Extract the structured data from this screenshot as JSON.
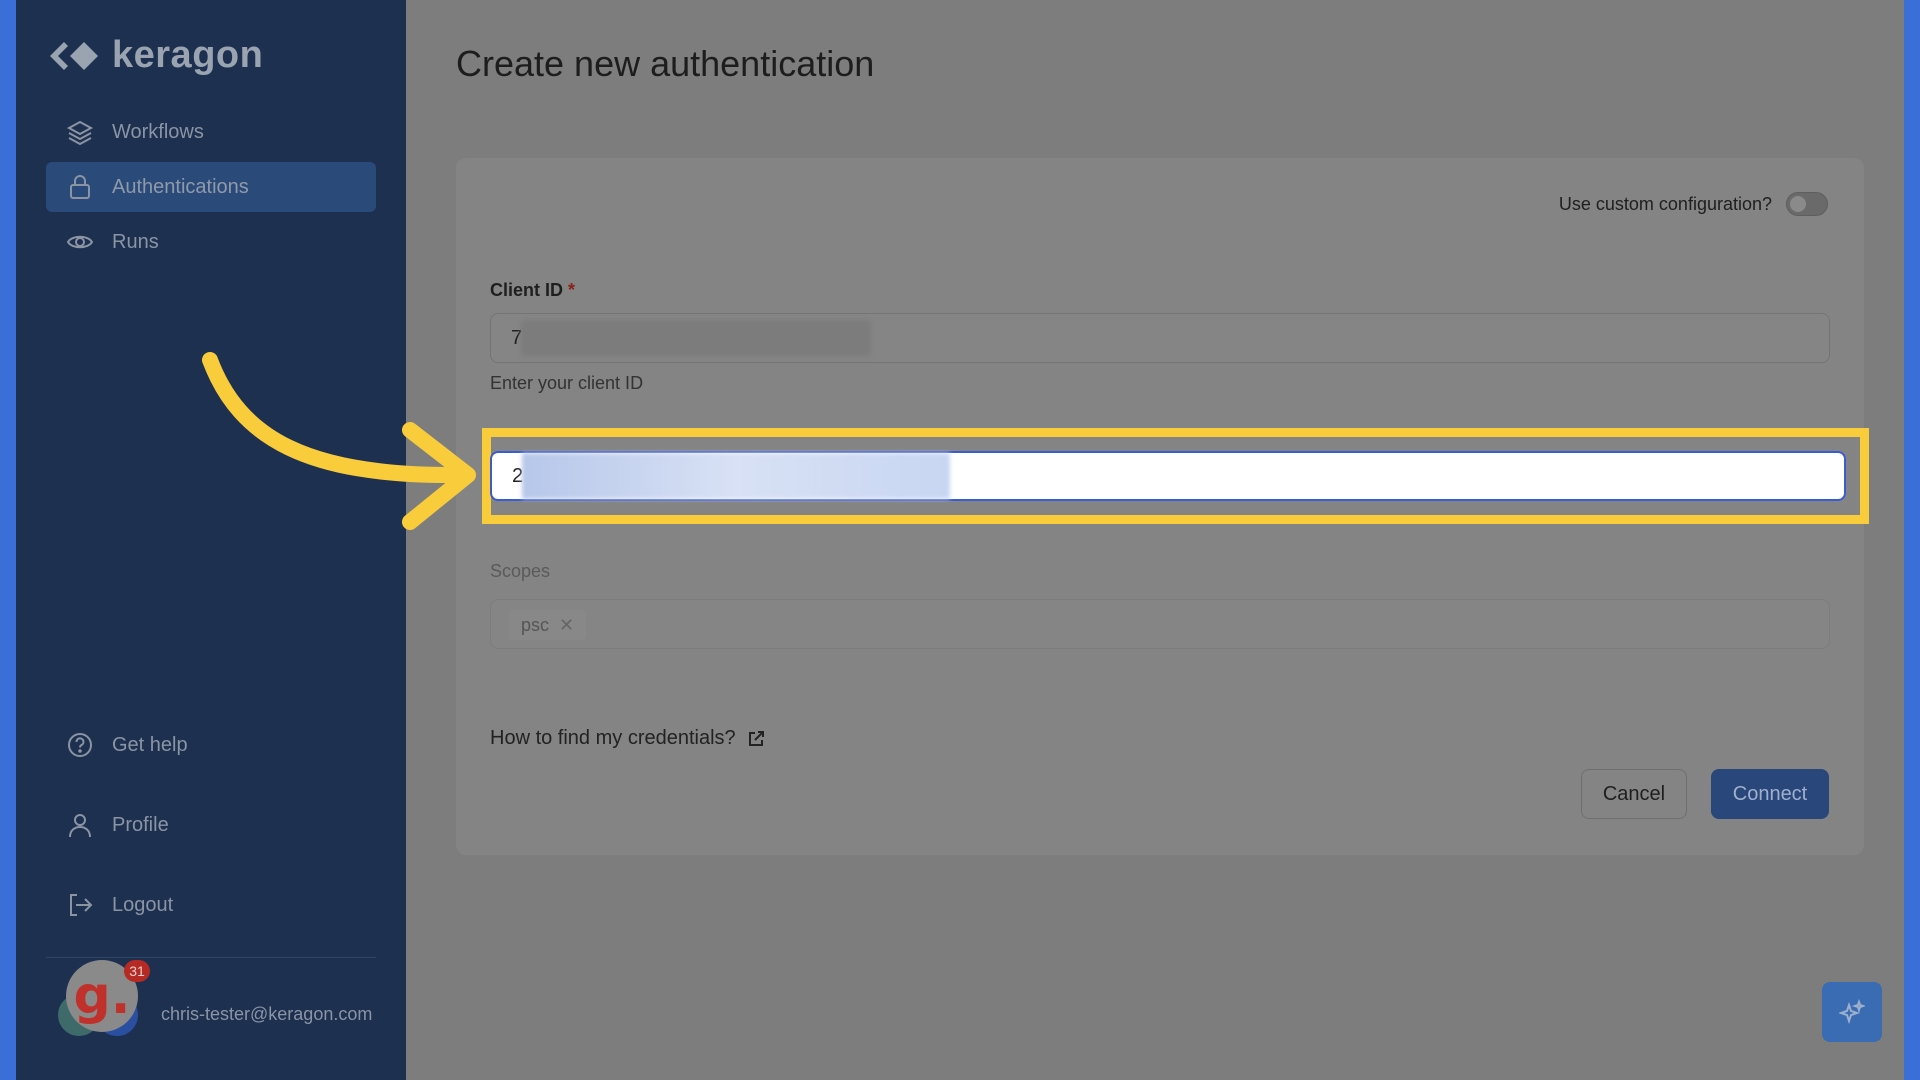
{
  "app": {
    "name": "keragon"
  },
  "sidebar": {
    "items": [
      {
        "label": "Workflows",
        "icon": "layers-icon"
      },
      {
        "label": "Authentications",
        "icon": "lock-icon",
        "active": true
      },
      {
        "label": "Runs",
        "icon": "eye-icon"
      }
    ],
    "bottom_items": [
      {
        "label": "Get help",
        "icon": "help-circle-icon"
      },
      {
        "label": "Profile",
        "icon": "user-icon"
      },
      {
        "label": "Logout",
        "icon": "logout-icon"
      }
    ],
    "user": {
      "email": "chris-tester@keragon.com",
      "notification_count": "31",
      "badge_letter": "g."
    }
  },
  "main": {
    "title": "Create new authentication",
    "custom_config_label": "Use custom configuration?",
    "client_id": {
      "label": "Client ID",
      "required_mark": "*",
      "value_prefix": "7",
      "hint": "Enter your client ID"
    },
    "client_secret": {
      "value_prefix": "2"
    },
    "scopes": {
      "label": "Scopes",
      "chips": [
        "psc"
      ]
    },
    "help_link": "How to find my credentials?",
    "cancel_label": "Cancel",
    "connect_label": "Connect"
  },
  "colors": {
    "highlight": "#f8cc3a",
    "sidebar_bg": "#1d3050",
    "primary_button": "#29477a",
    "frame_border": "#3a6fd8"
  }
}
